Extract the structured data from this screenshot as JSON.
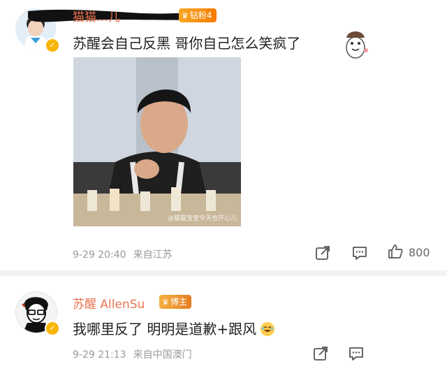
{
  "comments": [
    {
      "username": "猫猫…儿",
      "fan_badge": "钻粉4",
      "text": "苏醒会自己反黑 哥你自己怎么笑疯了",
      "photo_watermark": "@猫猫宝宝今天也开心儿",
      "date": "9-29 20:40",
      "location": "来自江苏",
      "like_count": "800"
    },
    {
      "username": "苏醒 AllenSu",
      "fan_badge": "博主",
      "text": "我哪里反了 明明是道歉+跟风",
      "date": "9-29 21:13",
      "location": "来自中国澳门"
    }
  ],
  "colors": {
    "username": "#eb7350",
    "badge": "#f57c00",
    "verified": "#f7b500",
    "meta": "#999999"
  },
  "icons": [
    "share-icon",
    "comment-icon",
    "like-icon",
    "crown-icon",
    "verified-icon"
  ]
}
